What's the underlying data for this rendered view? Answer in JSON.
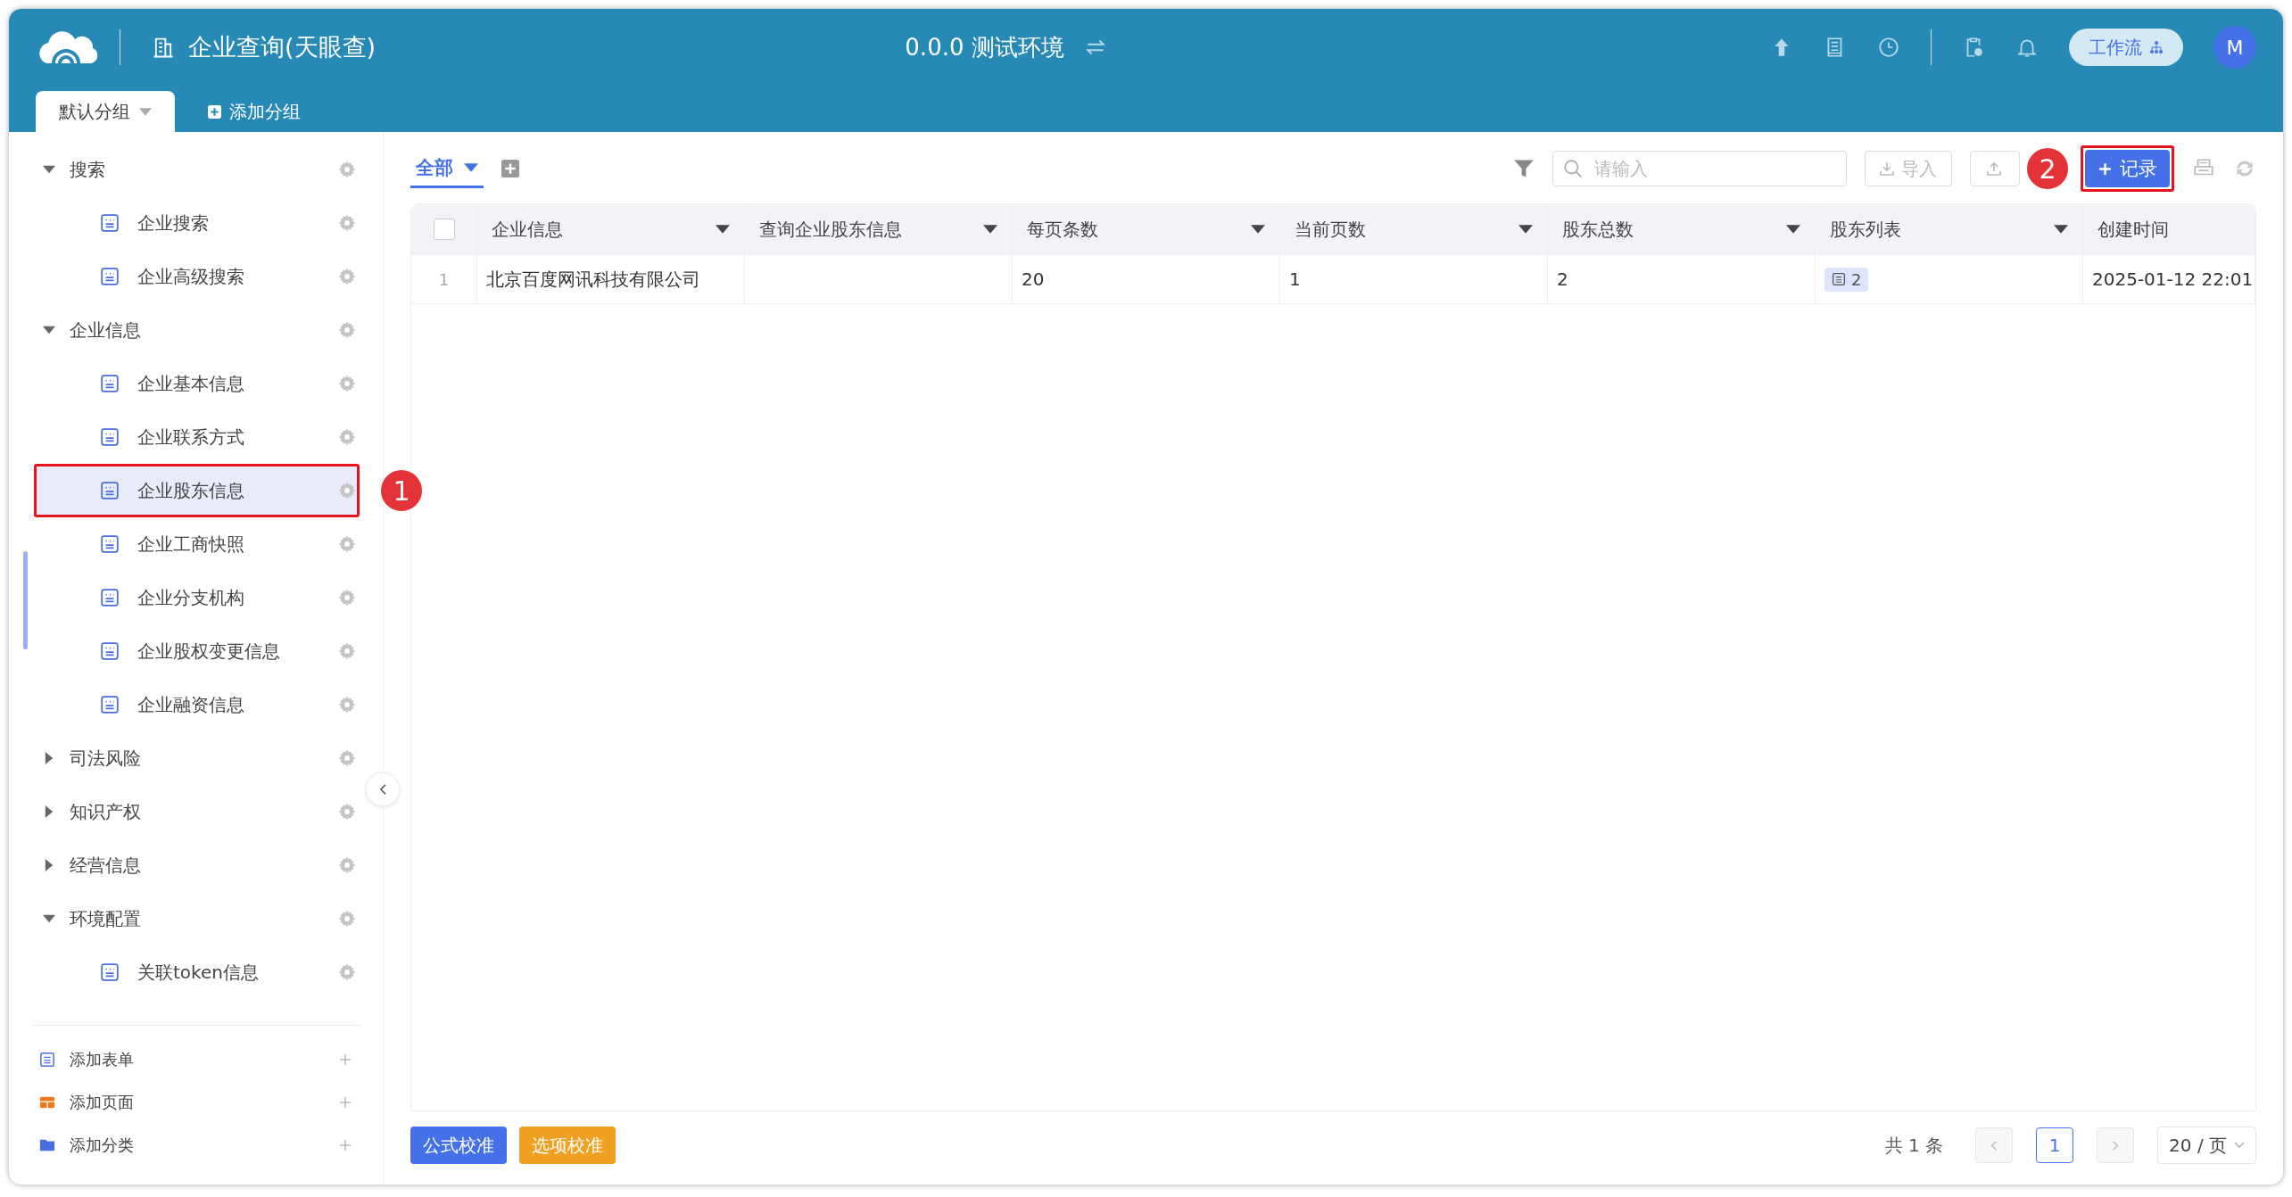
{
  "header": {
    "title": "企业查询(天眼查)",
    "environment": "0.0.0 测试环境",
    "workflow_button": "工作流",
    "avatar": "M"
  },
  "group_tabs": [
    {
      "label": "默认分组",
      "selected": true
    }
  ],
  "add_group": "添加分组",
  "sidebar": {
    "tree": [
      {
        "label": "搜索",
        "expanded": true,
        "children": [
          {
            "label": "企业搜索",
            "selected": false
          },
          {
            "label": "企业高级搜索",
            "selected": false
          }
        ]
      },
      {
        "label": "企业信息",
        "expanded": true,
        "children": [
          {
            "label": "企业基本信息",
            "selected": false
          },
          {
            "label": "企业联系方式",
            "selected": false
          },
          {
            "label": "企业股东信息",
            "selected": true,
            "callout": "1"
          },
          {
            "label": "企业工商快照",
            "selected": false
          },
          {
            "label": "企业分支机构",
            "selected": false
          },
          {
            "label": "企业股权变更信息",
            "selected": false
          },
          {
            "label": "企业融资信息",
            "selected": false
          }
        ]
      },
      {
        "label": "司法风险",
        "expanded": false
      },
      {
        "label": "知识产权",
        "expanded": false
      },
      {
        "label": "经营信息",
        "expanded": false
      },
      {
        "label": "环境配置",
        "expanded": true,
        "children": [
          {
            "label": "关联token信息",
            "selected": false
          }
        ]
      }
    ],
    "actions": [
      {
        "kind": "form",
        "label": "添加表单"
      },
      {
        "kind": "page",
        "label": "添加页面"
      },
      {
        "kind": "category",
        "label": "添加分类"
      }
    ]
  },
  "views": [
    {
      "label": "全部",
      "selected": true
    }
  ],
  "toolbar": {
    "search_placeholder": "请输入",
    "import_button": "导入",
    "add_record_button": {
      "label": "记录",
      "callout": "2"
    }
  },
  "table": {
    "select_all_checked": false,
    "columns": [
      {
        "label": "企业信息",
        "menu": true
      },
      {
        "label": "查询企业股东信息",
        "menu": true
      },
      {
        "label": "每页条数",
        "menu": true
      },
      {
        "label": "当前页数",
        "menu": true
      },
      {
        "label": "股东总数",
        "menu": true
      },
      {
        "label": "股东列表",
        "menu": true
      },
      {
        "label": "创建时间",
        "menu": false
      }
    ],
    "rows": [
      {
        "index": "1",
        "cells": [
          {
            "kind": "text",
            "text": "北京百度网讯科技有限公司"
          },
          {
            "kind": "empty"
          },
          {
            "kind": "text",
            "text": "20"
          },
          {
            "kind": "text",
            "text": "1"
          },
          {
            "kind": "text",
            "text": "2"
          },
          {
            "kind": "tag",
            "text": "2"
          },
          {
            "kind": "text",
            "text": "2025-01-12 22:01"
          }
        ]
      }
    ]
  },
  "footer": {
    "buttons": [
      {
        "label": "公式校准",
        "kind": "primary"
      },
      {
        "label": "选项校准",
        "kind": "warning"
      }
    ],
    "total": "共 1 条",
    "pages": [
      {
        "label": "1",
        "selected": true
      }
    ],
    "page_size": "20 / 页"
  }
}
